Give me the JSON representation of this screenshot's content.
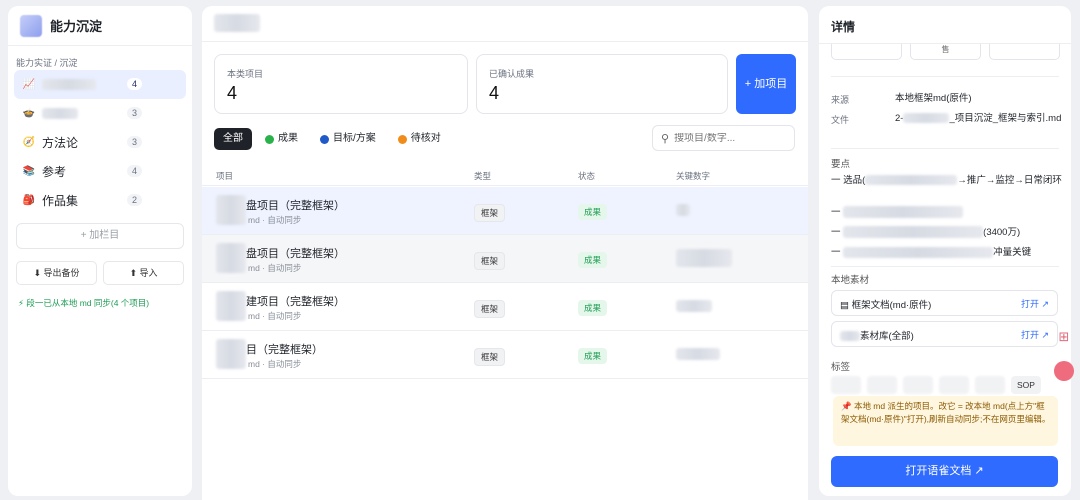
{
  "sidebar": {
    "brand_title": "能力沉淀",
    "breadcrumb": "能力实证 / 沉淀",
    "items": [
      {
        "icon": "chart-icon",
        "glyph": "📈",
        "label": "",
        "count": "4"
      },
      {
        "icon": "pot-icon",
        "glyph": "🍲",
        "label": "",
        "count": "3"
      },
      {
        "icon": "compass-icon",
        "glyph": "🧭",
        "label": "方法论",
        "count": "3"
      },
      {
        "icon": "books-icon",
        "glyph": "📚",
        "label": "参考",
        "count": "4"
      },
      {
        "icon": "bag-icon",
        "glyph": "🎒",
        "label": "作品集",
        "count": "2"
      }
    ],
    "add_column": "+ 加栏目",
    "export_label": "⬇ 导出备份",
    "import_label": "⬆ 导入",
    "sync_note": "⚡ 段一已从本地 md 同步(4 个项目)"
  },
  "main": {
    "stats": [
      {
        "label": "本类项目",
        "value": "4"
      },
      {
        "label": "已确认成果",
        "value": "4"
      }
    ],
    "add_button": "+ 加项目",
    "filters": [
      {
        "label": "全部",
        "color": ""
      },
      {
        "label": "成果",
        "color": "#2ab24a"
      },
      {
        "label": "目标/方案",
        "color": "#2259c9"
      },
      {
        "label": "待核对",
        "color": "#f08c1a"
      }
    ],
    "search_placeholder": "搜项目/数字...",
    "columns": [
      "项目",
      "类型",
      "状态",
      "关键数字"
    ],
    "rows": [
      {
        "title": "盘项目（完整框架）",
        "sub": "md · 自动同步",
        "type": "框架",
        "status": "成果"
      },
      {
        "title": "盘项目（完整框架）",
        "sub": "md · 自动同步",
        "type": "框架",
        "status": "成果"
      },
      {
        "title": "建项目（完整框架）",
        "sub": "md · 自动同步",
        "type": "框架",
        "status": "成果"
      },
      {
        "title": "目（完整框架）",
        "sub": "md · 自动同步",
        "type": "框架",
        "status": "成果"
      }
    ]
  },
  "detail": {
    "title": "详情",
    "top_box_label": "售",
    "source_key": "来源",
    "source_value": "本地框架md(原件)",
    "file_key": "文件",
    "file_value_prefix": "2-",
    "file_value_rest": "_项目沉淀_框架与索引.md",
    "points_title": "要点",
    "points": [
      {
        "prefix": "一 选品(",
        "suffix": "→推广→监控→日常闭环"
      },
      {
        "prefix": "一",
        "suffix": ""
      },
      {
        "prefix": "一",
        "suffix": "(3400万)"
      },
      {
        "prefix": "一",
        "suffix": "冲量关键"
      }
    ],
    "materials_title": "本地素材",
    "materials": [
      {
        "label": "▤ 框架文档(md·原件)",
        "open": "打开 ↗"
      },
      {
        "label": "素材库(全部)",
        "open": "打开 ↗"
      }
    ],
    "tags_title": "标签",
    "tag_last": "SOP",
    "note": "📌 本地 md 派生的项目。改它 = 改本地 md(点上方\"框架文档(md·原件)\"打开),刷新自动同步;不在网页里编辑。",
    "open_button": "打开语雀文档 ↗"
  }
}
